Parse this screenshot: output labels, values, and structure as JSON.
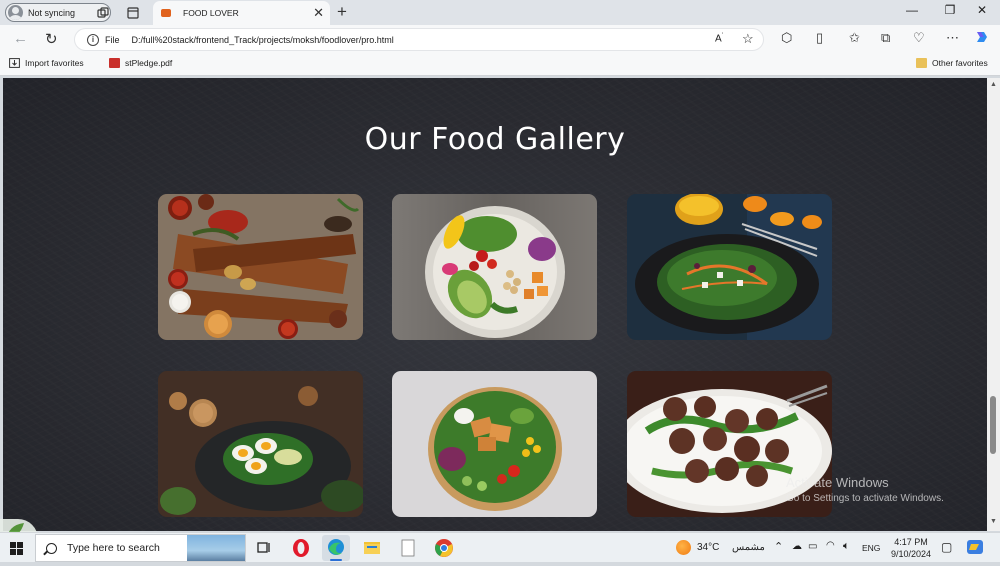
{
  "browser": {
    "profile_label": "Not syncing",
    "tab_title": "FOOD LOVER",
    "address": {
      "scheme_label": "File",
      "url": "D:/full%20stack/frontend_Track/projects/moksh/foodlover/pro.html"
    },
    "favorites": [
      {
        "label": "Import favorites",
        "icon": "import-icon"
      },
      {
        "label": "stPledge.pdf",
        "icon": "pdf-icon"
      }
    ],
    "other_favorites": "Other favorites"
  },
  "page": {
    "gallery_title": "Our Food Gallery",
    "gallery": [
      {
        "subject": "grilled kebabs with sauces",
        "icon": "food-photo"
      },
      {
        "subject": "salad bowl with avocado and chickpeas",
        "icon": "food-photo"
      },
      {
        "subject": "green salad with orange juice",
        "icon": "food-photo"
      },
      {
        "subject": "boiled egg salad with cookies",
        "icon": "food-photo"
      },
      {
        "subject": "tofu salad bowl",
        "icon": "food-photo"
      },
      {
        "subject": "meatballs with arugula",
        "icon": "food-photo"
      }
    ]
  },
  "watermark": {
    "line1": "Activate Windows",
    "line2": "Go to Settings to activate Windows."
  },
  "taskbar": {
    "search_placeholder": "Type here to search",
    "weather": "34°C",
    "weather_desc": "مشمس",
    "language": "ENG",
    "time": "4:17 PM",
    "date": "9/10/2024"
  }
}
